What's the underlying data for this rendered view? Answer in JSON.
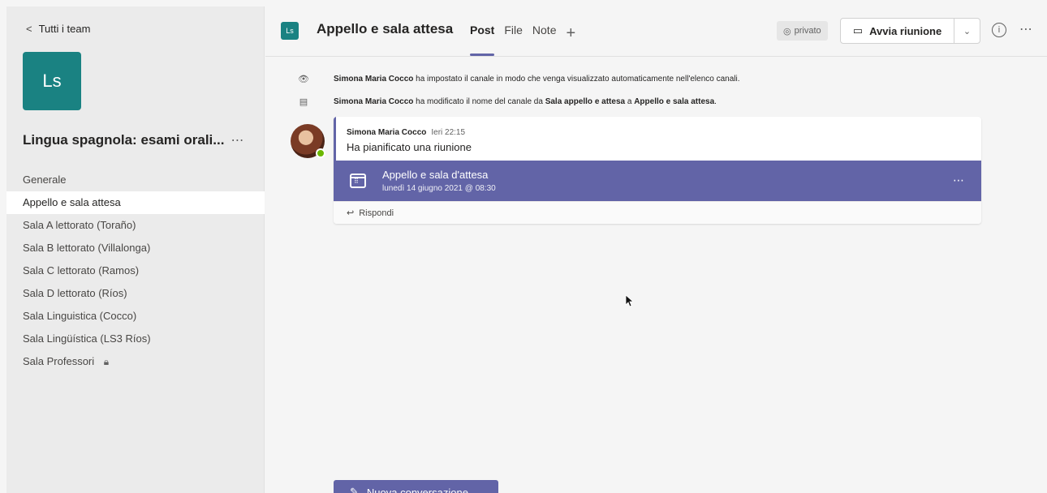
{
  "sidebar": {
    "back_label": "Tutti i team",
    "team_initials": "Ls",
    "team_name": "Lingua spagnola: esami orali...",
    "channels": [
      "Generale",
      "Appello e sala attesa",
      "Sala A lettorato (Toraño)",
      "Sala B lettorato (Villalonga)",
      "Sala C lettorato (Ramos)",
      "Sala D lettorato (Ríos)",
      "Sala Linguistica (Cocco)",
      "Sala Lingüística (LS3 Ríos)",
      "Sala Professori"
    ],
    "active_channel": "Appello e sala attesa"
  },
  "header": {
    "initials": "Ls",
    "channel_title": "Appello e sala attesa",
    "tabs": [
      "Post",
      "File",
      "Note"
    ],
    "privacy_label": "privato",
    "meet_button_label": "Avvia riunione"
  },
  "feed": {
    "system_messages": [
      {
        "actor": "Simona Maria Cocco",
        "text": " ha impostato il canale in modo che venga visualizzato automaticamente nell'elenco canali."
      },
      {
        "actor": "Simona Maria Cocco",
        "text_1": " ha modificato il nome del canale da ",
        "old_name": "Sala appello e attesa",
        "text_2": " a ",
        "new_name": "Appello e sala attesa",
        "text_3": "."
      }
    ],
    "post": {
      "author": "Simona Maria Cocco",
      "time": "Ieri 22:15",
      "text": "Ha pianificato una riunione",
      "meeting_title": "Appello e sala d'attesa",
      "meeting_date": "lunedì 14 giugno 2021 @ 08:30",
      "reply_label": "Rispondi"
    },
    "new_conversation_label": "Nuova conversazione"
  },
  "colors": {
    "accent": "#6264a7",
    "team_tile": "#1a8282",
    "presence": "#6bb700"
  }
}
